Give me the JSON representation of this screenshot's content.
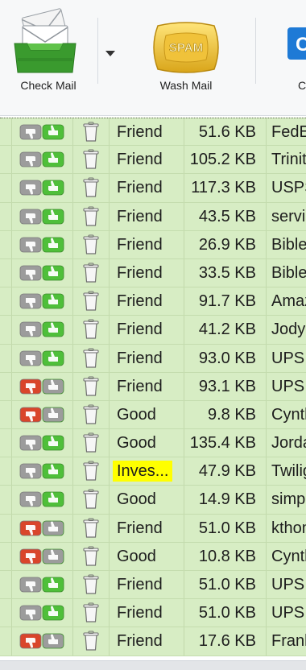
{
  "toolbar": {
    "check_mail_label": "Check Mail",
    "wash_mail_label": "Wash Mail",
    "third_label": "C",
    "wash_badge_text": "SPAM"
  },
  "colors": {
    "row_bg": "#d7edc4",
    "toolbar_bg": "#f7f8f9",
    "highlight": "#ffff00",
    "thumb_green": "#4fbf3a",
    "thumb_red": "#d9452b",
    "thumb_gray": "#9c9c9c"
  },
  "rows": [
    {
      "vote": "up",
      "rating": "Friend",
      "size": "51.6 KB",
      "sender": "FedEx",
      "highlight": false
    },
    {
      "vote": "up",
      "rating": "Friend",
      "size": "105.2 KB",
      "sender": "Trinity",
      "highlight": false
    },
    {
      "vote": "up",
      "rating": "Friend",
      "size": "117.3 KB",
      "sender": "USPS",
      "highlight": false
    },
    {
      "vote": "up",
      "rating": "Friend",
      "size": "43.5 KB",
      "sender": "service",
      "highlight": false
    },
    {
      "vote": "up",
      "rating": "Friend",
      "size": "26.9 KB",
      "sender": "Bible",
      "highlight": false
    },
    {
      "vote": "up",
      "rating": "Friend",
      "size": "33.5 KB",
      "sender": "Bible",
      "highlight": false
    },
    {
      "vote": "up",
      "rating": "Friend",
      "size": "91.7 KB",
      "sender": "Amazon",
      "highlight": false
    },
    {
      "vote": "up",
      "rating": "Friend",
      "size": "41.2 KB",
      "sender": "Jody",
      "highlight": false
    },
    {
      "vote": "up",
      "rating": "Friend",
      "size": "93.0 KB",
      "sender": "UPS",
      "highlight": false
    },
    {
      "vote": "down",
      "rating": "Friend",
      "size": "93.1 KB",
      "sender": "UPS",
      "highlight": false
    },
    {
      "vote": "down",
      "rating": "Good",
      "size": "9.8 KB",
      "sender": "Cynthia",
      "highlight": false
    },
    {
      "vote": "up",
      "rating": "Good",
      "size": "135.4 KB",
      "sender": "Jordan",
      "highlight": false
    },
    {
      "vote": "up",
      "rating": "Inves...",
      "size": "47.9 KB",
      "sender": "Twilight",
      "highlight": true
    },
    {
      "vote": "up",
      "rating": "Good",
      "size": "14.9 KB",
      "sender": "simple",
      "highlight": false
    },
    {
      "vote": "down",
      "rating": "Friend",
      "size": "51.0 KB",
      "sender": "kthomas",
      "highlight": false
    },
    {
      "vote": "down",
      "rating": "Good",
      "size": "10.8 KB",
      "sender": "Cynthia",
      "highlight": false
    },
    {
      "vote": "up",
      "rating": "Friend",
      "size": "51.0 KB",
      "sender": "UPS",
      "highlight": false
    },
    {
      "vote": "up",
      "rating": "Friend",
      "size": "51.0 KB",
      "sender": "UPS",
      "highlight": false
    },
    {
      "vote": "down",
      "rating": "Friend",
      "size": "17.6 KB",
      "sender": "Frank",
      "highlight": false
    }
  ]
}
